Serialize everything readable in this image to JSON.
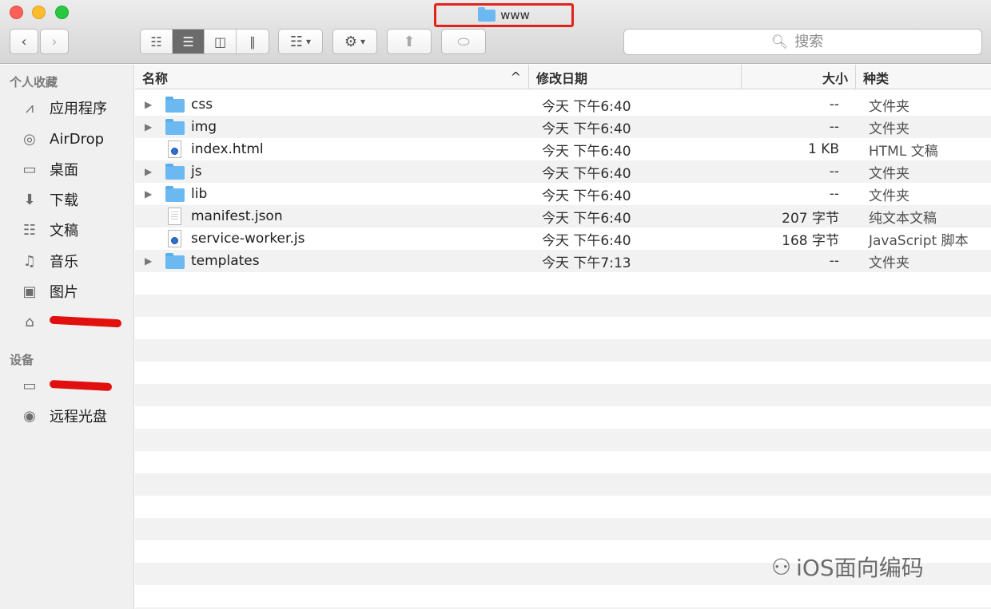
{
  "window": {
    "title": "www",
    "colors": {
      "close": "#fc5f57",
      "minimize": "#fdbc2e",
      "maximize": "#28c840",
      "title_highlight": "#e0241b"
    }
  },
  "toolbar": {
    "back_icon": "chevron-left-icon",
    "forward_icon": "chevron-right-icon",
    "views": [
      "icon-view-icon",
      "list-view-icon",
      "column-view-icon",
      "cover-flow-icon"
    ],
    "active_view": "list-view-icon",
    "arrange_icon": "arrange-icon",
    "action_icon": "gear-icon",
    "share_icon": "share-icon",
    "tag_icon": "tag-icon",
    "search": {
      "placeholder": "搜索"
    }
  },
  "sidebar": {
    "favorites_header": "个人收藏",
    "favorites": [
      {
        "label": "应用程序",
        "icon": "applications-icon"
      },
      {
        "label": "AirDrop",
        "icon": "airdrop-icon"
      },
      {
        "label": "桌面",
        "icon": "desktop-icon"
      },
      {
        "label": "下载",
        "icon": "downloads-icon"
      },
      {
        "label": "文稿",
        "icon": "documents-icon"
      },
      {
        "label": "音乐",
        "icon": "music-icon"
      },
      {
        "label": "图片",
        "icon": "pictures-icon"
      },
      {
        "label": "",
        "icon": "home-icon"
      }
    ],
    "devices_header": "设备",
    "devices": [
      {
        "label": "",
        "icon": "laptop-icon"
      },
      {
        "label": "远程光盘",
        "icon": "remote-disc-icon"
      }
    ]
  },
  "list": {
    "columns": {
      "name": "名称",
      "date": "修改日期",
      "size": "大小",
      "kind": "种类"
    },
    "sort_indicator": "^",
    "rows": [
      {
        "name": "css",
        "date": "今天 下午6:40",
        "size": "--",
        "kind": "文件夹",
        "type": "folder"
      },
      {
        "name": "img",
        "date": "今天 下午6:40",
        "size": "--",
        "kind": "文件夹",
        "type": "folder"
      },
      {
        "name": "index.html",
        "date": "今天 下午6:40",
        "size": "1 KB",
        "kind": "HTML 文稿",
        "type": "web"
      },
      {
        "name": "js",
        "date": "今天 下午6:40",
        "size": "--",
        "kind": "文件夹",
        "type": "folder"
      },
      {
        "name": "lib",
        "date": "今天 下午6:40",
        "size": "--",
        "kind": "文件夹",
        "type": "folder"
      },
      {
        "name": "manifest.json",
        "date": "今天 下午6:40",
        "size": "207 字节",
        "kind": "纯文本文稿",
        "type": "text"
      },
      {
        "name": "service-worker.js",
        "date": "今天 下午6:40",
        "size": "168 字节",
        "kind": "JavaScript 脚本",
        "type": "web"
      },
      {
        "name": "templates",
        "date": "今天 下午7:13",
        "size": "--",
        "kind": "文件夹",
        "type": "folder"
      }
    ]
  },
  "watermark": {
    "text": "iOS面向编码"
  }
}
